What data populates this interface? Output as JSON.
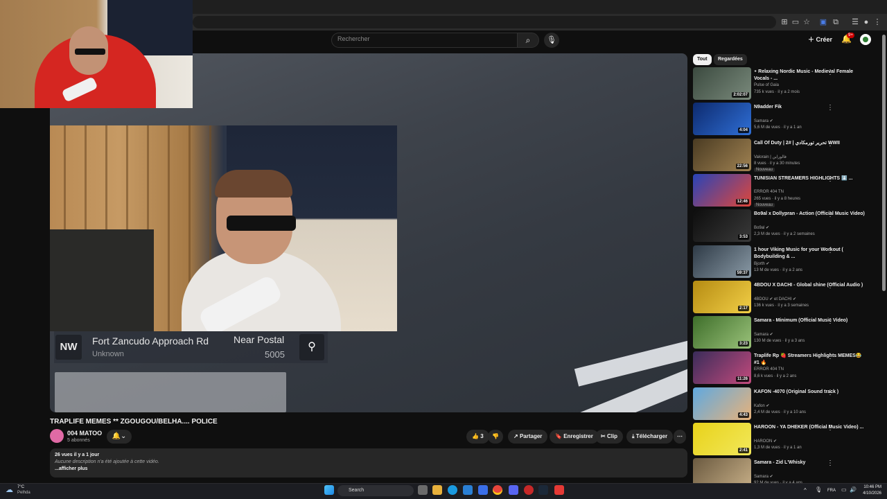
{
  "header": {
    "search_placeholder": "Rechercher",
    "create_label": "Créer",
    "notif_count": "9+"
  },
  "video": {
    "hud": {
      "direction": "NW",
      "street": "Fort Zancudo Approach Rd",
      "area": "Unknown",
      "postal_label": "Near Postal",
      "postal_code": "5005"
    },
    "title": "TRAPLIFE MEMES ** ZGOUGOU/BELHA.... POLICE",
    "channel": "004 MATOO",
    "subscribers": "5 abonnés",
    "likes": "3",
    "actions": {
      "share": "Partager",
      "save": "Enregistrer",
      "clip": "Clip",
      "download": "Télécharger"
    },
    "description": {
      "meta": "26 vues  il y a 1 jour",
      "text": "Aucune description n'a été ajoutée à cette vidéo.",
      "more": "...afficher plus"
    }
  },
  "sidebar": {
    "chips": [
      "Tout",
      "Regardées"
    ],
    "recommendations": [
      {
        "title": "᛭ Relaxing Nordic Music - Medieval Female Vocals - ...",
        "channel": "Pulse of Gaia",
        "meta": "735 k vues · il y a 2 mois",
        "duration": "2:02:07",
        "badge": ""
      },
      {
        "title": "N9adder Fik",
        "channel": "Samara ✔",
        "meta": "5,6 M de vues · il y a 1 an",
        "duration": "4:04",
        "badge": ""
      },
      {
        "title": "Call Of Duty | تحرير تورمكادي | #2 WWII",
        "channel": "Valorain | فالوراين",
        "meta": "8 vues · il y a 30 minutes",
        "duration": "22:56",
        "badge": "Nouveau"
      },
      {
        "title": "TUNISIAN STREAMERS HIGHLIGHTS ⬇️ ...",
        "channel": "ERROR 404 TN",
        "meta": "265 vues · il y a 8 heures",
        "duration": "12:46",
        "badge": "Nouveau"
      },
      {
        "title": "Bo9al x Dollypran - Action (Official Music Video)",
        "channel": "Bo9al ✔",
        "meta": "2,3 M de vues · il y a 2 semaines",
        "duration": "3:53",
        "badge": ""
      },
      {
        "title": "1 hour Viking Music for your Workout ( Bodybuilding & ...",
        "channel": "Bjorth ✔",
        "meta": "13 M de vues · il y a 2 ans",
        "duration": "59:37",
        "badge": ""
      },
      {
        "title": "4BDOU X DACHI - Global shine (Official Audio )",
        "channel": "4BDOU ✔ et DACHI ✔",
        "meta": "136 k vues · il y a 3 semaines",
        "duration": "2:17",
        "badge": ""
      },
      {
        "title": "Samara - Minimum (Official Music Video)",
        "channel": "Samara ✔",
        "meta": "130 M de vues · il y a 3 ans",
        "duration": "3:23",
        "badge": ""
      },
      {
        "title": "Traplife Rp 🍓 Streamers Highlights MEMES😂 #1 🔥",
        "channel": "ERROR 404 TN",
        "meta": "8,6 k vues · il y a 2 ans",
        "duration": "11:26",
        "badge": ""
      },
      {
        "title": "KAFON -4070 (Original Sound track )",
        "channel": "Kafon ✔",
        "meta": "2,4 M de vues · il y a 10 ans",
        "duration": "4:43",
        "badge": ""
      },
      {
        "title": "HAROON - YA DHEKER (Official Music Video) ...",
        "channel": "HAROON ✔",
        "meta": "1,3 M de vues · il y a 1 an",
        "duration": "2:41",
        "badge": ""
      },
      {
        "title": "Samara - Zid L'Whisky",
        "channel": "Samara ✔",
        "meta": "92 M de vues · il y a 4 ans",
        "duration": "",
        "badge": ""
      }
    ]
  },
  "taskbar": {
    "weather_temp": "7°C",
    "weather_desc": "Pelhda",
    "search_label": "Search",
    "lang": "FRA",
    "time": "10:46 PM",
    "date": "4/10/2026"
  },
  "colors": {
    "accent_red": "#cc0000",
    "surface": "#272727",
    "background": "#0f0f0f"
  }
}
